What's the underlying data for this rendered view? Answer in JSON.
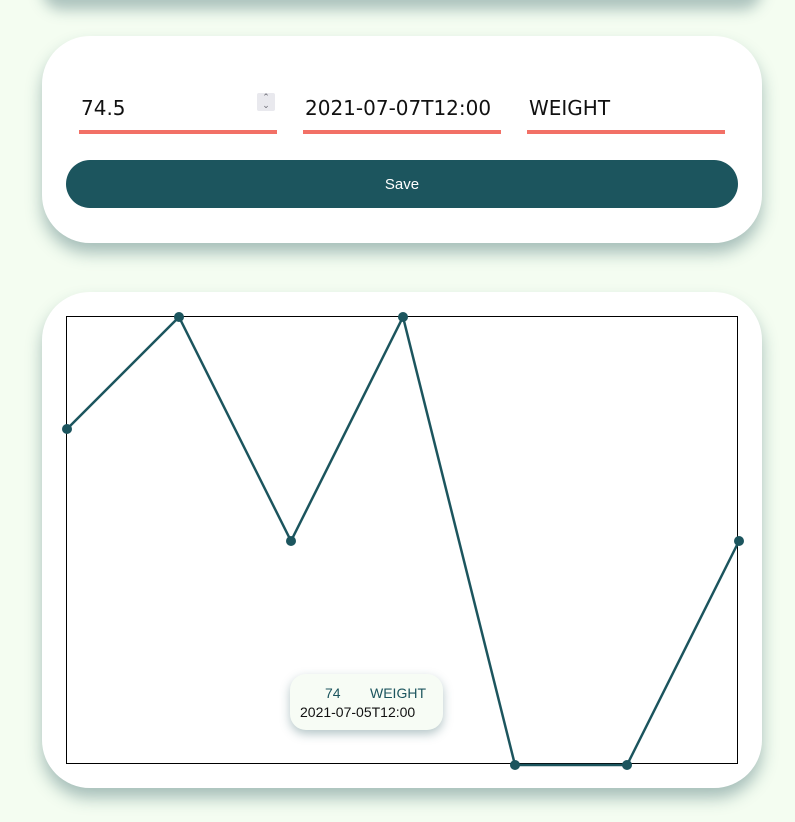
{
  "form": {
    "value_input": "74.5",
    "date_input": "2021-07-07T12:00",
    "type_input": "WEIGHT",
    "spinner_icon": "stepper-arrows-icon",
    "save_label": "Save"
  },
  "tooltip": {
    "value": "74",
    "type": "WEIGHT",
    "date": "2021-07-05T12:00"
  },
  "colors": {
    "accent": "#1c555e",
    "underline": "#f27066",
    "background": "#f4fdf1"
  },
  "chart_data": {
    "type": "line",
    "x": [
      "",
      "",
      "2021-07-05T12:00",
      "",
      "",
      "",
      ""
    ],
    "series": [
      {
        "values": [
          75,
          76,
          74,
          76,
          72,
          72,
          74
        ]
      }
    ],
    "ylim": [
      72,
      76
    ],
    "title": "",
    "xlabel": "",
    "ylabel": "",
    "grid": false
  }
}
